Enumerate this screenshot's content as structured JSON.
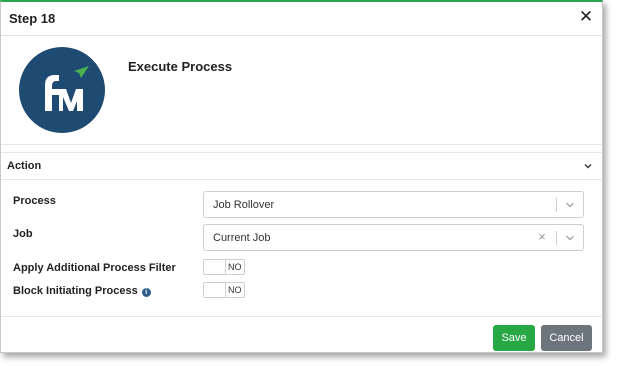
{
  "dialog": {
    "title": "Step 18",
    "close_glyph": "✕",
    "heading": "Execute Process"
  },
  "logo": {
    "icon": "fym-logo",
    "bg_color": "#1f4b72",
    "accent_color": "#4caf50"
  },
  "action_section": {
    "label": "Action",
    "collapse_icon": "chevron-down-icon"
  },
  "form": {
    "process": {
      "label": "Process",
      "value": "Job Rollover"
    },
    "job": {
      "label": "Job",
      "value": "Current Job",
      "clear_glyph": "×"
    },
    "apply_filter": {
      "label": "Apply Additional Process Filter",
      "state": "NO"
    },
    "block_initiating": {
      "label": "Block Initiating Process",
      "state": "NO",
      "info_glyph": "i"
    }
  },
  "buttons": {
    "save_label": "Save",
    "cancel_label": "Cancel",
    "save_color": "#28a745",
    "cancel_color": "#6c757d"
  },
  "accent_color": "#2ba34a"
}
